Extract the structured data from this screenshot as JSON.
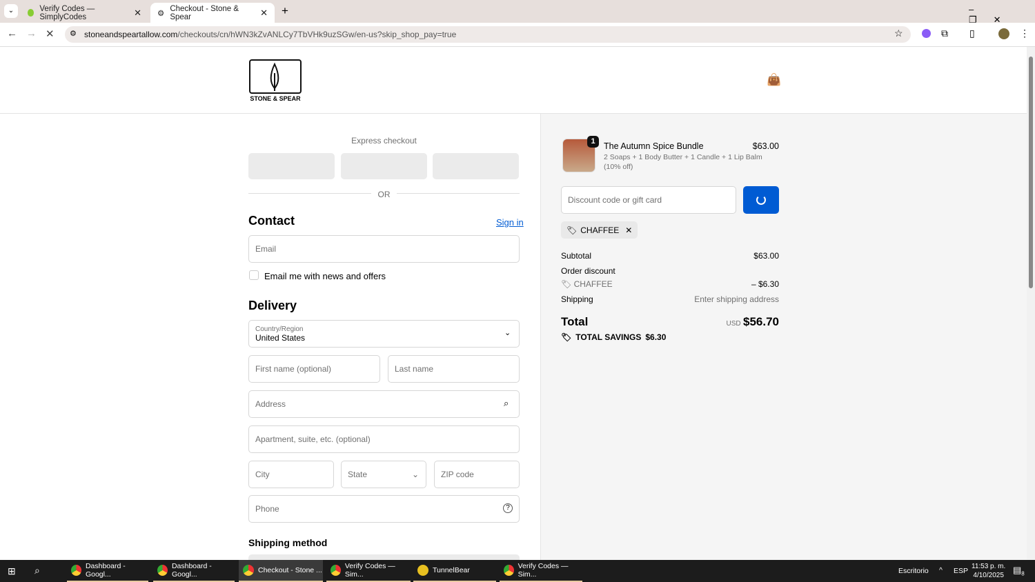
{
  "browser": {
    "tabs": [
      {
        "label": "Verify Codes — SimplyCodes"
      },
      {
        "label": "Checkout - Stone & Spear"
      }
    ],
    "url_domain": "stoneandspeartallow.com",
    "url_path": "/checkouts/cn/hWN3kZvANLCy7TbVHk9uzSGw/en-us?skip_shop_pay=true"
  },
  "header": {
    "logo_text": "STONE & SPEAR"
  },
  "checkout": {
    "express_label": "Express checkout",
    "or_label": "OR",
    "contact_heading": "Contact",
    "sign_in": "Sign in",
    "email_placeholder": "Email",
    "newsletter_label": "Email me with news and offers",
    "delivery_heading": "Delivery",
    "country_label": "Country/Region",
    "country_value": "United States",
    "first_name": "First name (optional)",
    "last_name": "Last name",
    "address": "Address",
    "apartment": "Apartment, suite, etc. (optional)",
    "city": "City",
    "state": "State",
    "zip": "ZIP code",
    "phone": "Phone",
    "shipping_method_heading": "Shipping method"
  },
  "summary": {
    "item": {
      "qty": "1",
      "name": "The Autumn Spice Bundle",
      "desc": "2 Soaps + 1 Body Butter + 1 Candle + 1 Lip Balm",
      "desc2": "(10% off)",
      "price": "$63.00"
    },
    "discount_placeholder": "Discount code or gift card",
    "code": "CHAFFEE",
    "subtotal_label": "Subtotal",
    "subtotal": "$63.00",
    "order_discount_label": "Order discount",
    "discount_code": "CHAFFEE",
    "discount_amount": "– $6.30",
    "shipping_label": "Shipping",
    "shipping_value": "Enter shipping address",
    "total_label": "Total",
    "currency": "USD",
    "total": "$56.70",
    "savings_label": "TOTAL SAVINGS",
    "savings": "$6.30"
  },
  "taskbar": {
    "items": [
      "Dashboard - Googl...",
      "Dashboard - Googl...",
      "Checkout - Stone ...",
      "Verify Codes — Sim...",
      "TunnelBear",
      "Verify Codes — Sim..."
    ],
    "desktop": "Escritorio",
    "lang": "ESP",
    "time": "11:53 p. m.",
    "date": "4/10/2025",
    "notif": "8"
  },
  "colors": {
    "accent": "#005bd3",
    "link": "#005bd3"
  }
}
